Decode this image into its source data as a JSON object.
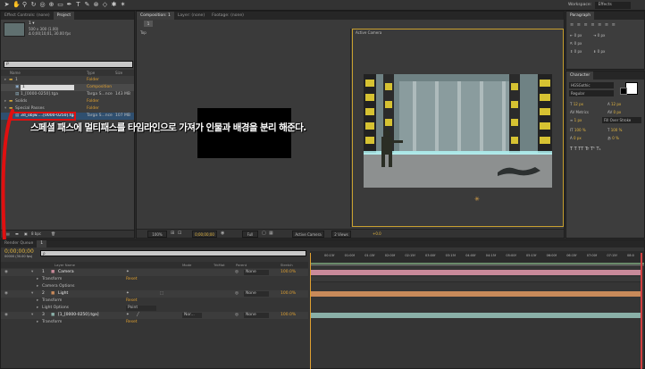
{
  "workspace": {
    "label": "Workspace:",
    "value": "Effects"
  },
  "tabs": {
    "effect_controls": "Effect Controls: (none)",
    "project": "Project",
    "composition": "Composition: 1",
    "layer": "Layer: (none)",
    "footage": "Footage: (none)",
    "paragraph": "Paragraph",
    "character": "Character",
    "render_queue": "Render Queue",
    "timeline_comp": "1"
  },
  "project": {
    "item_name": "1 ▾",
    "item_info1": "500 x 300 (1.00)",
    "item_info2": "Δ 0;00;10;01, 30.00 fps",
    "search_placeholder": "ρ",
    "columns": {
      "name": "Name",
      "type": "Type",
      "size": "Size"
    },
    "rows": [
      {
        "name": "1",
        "type": "Folder",
        "size": ""
      },
      {
        "name": "1",
        "type": "Composition",
        "size": ""
      },
      {
        "name": "1_[0000-0250].tga",
        "type": "Targa S...nce",
        "size": "143 MB"
      },
      {
        "name": "Solids",
        "type": "Folder",
        "size": ""
      },
      {
        "name": "Special Passes",
        "type": "Folder",
        "size": ""
      },
      {
        "name": "3d_objw.....[0000-0250].tga",
        "type": "Targa S...nce",
        "size": "107 MB"
      }
    ],
    "bpc": "8 bpc"
  },
  "comp_view": {
    "left_label": "Top",
    "right_label": "Active Camera",
    "zoom": "100%",
    "timecode": "0;00;00;00",
    "resolution": "Full",
    "camera": "Active Camera",
    "views": "2 Views",
    "exposure": "+0.0"
  },
  "annotation": "스페셜 패스에 멀티패스를 타임라인으로 가져가 인물과 배경을 분리 해준다.",
  "character": {
    "font": "HGSGothic",
    "style": "Regular",
    "size1": "12 px",
    "size2": "12 px",
    "tracking": "0 px",
    "leading": "Auto",
    "kerning": "Metrics",
    "fill": "Fill Over Stroke",
    "vscale": "100 %",
    "hscale": "100 %",
    "baseline": "0 px",
    "tsume": "0 %",
    "stroke": "1 px",
    "para_indent": "0 px",
    "para_space": "0 px",
    "style_icons": "T  T  TT  Tr  T¹  T₁"
  },
  "timeline": {
    "timecode": "0;00;00;00",
    "fps": "00000 (30.00 fps)",
    "search_placeholder": "ρ",
    "columns": {
      "source": "Layer Name",
      "mode": "Mode",
      "trkmat": "TrkMat",
      "parent": "Parent",
      "stretch": "Stretch"
    },
    "layers": [
      {
        "num": "1",
        "name": "Camera",
        "parent": "None",
        "stretch": "100.0%"
      },
      {
        "num": "2",
        "name": "Light",
        "parent": "None",
        "stretch": "100.0%"
      },
      {
        "num": "3",
        "name": "[1_[0000-0250].tga]",
        "mode": "Nor...",
        "parent": "None",
        "stretch": "100.0%"
      }
    ],
    "sub": {
      "transform": "Transform",
      "camera_options": "Camera Options",
      "light_options": "Light Options",
      "reset": "Reset",
      "point": "Point"
    },
    "ruler": [
      "00:15f",
      "01:00f",
      "01:15f",
      "02:00f",
      "02:15f",
      "03:00f",
      "03:15f",
      "04:00f",
      "04:15f",
      "05:00f",
      "05:15f",
      "06:00f",
      "06:15f",
      "07:00f",
      "07:15f",
      "08:0"
    ]
  },
  "colors": {
    "accent_orange": "#e0a030",
    "camera_bar": "#c98a9a",
    "light_bar": "#c88a5a",
    "footage_bar": "#8ab0a8",
    "highlight_red": "#e01010"
  }
}
